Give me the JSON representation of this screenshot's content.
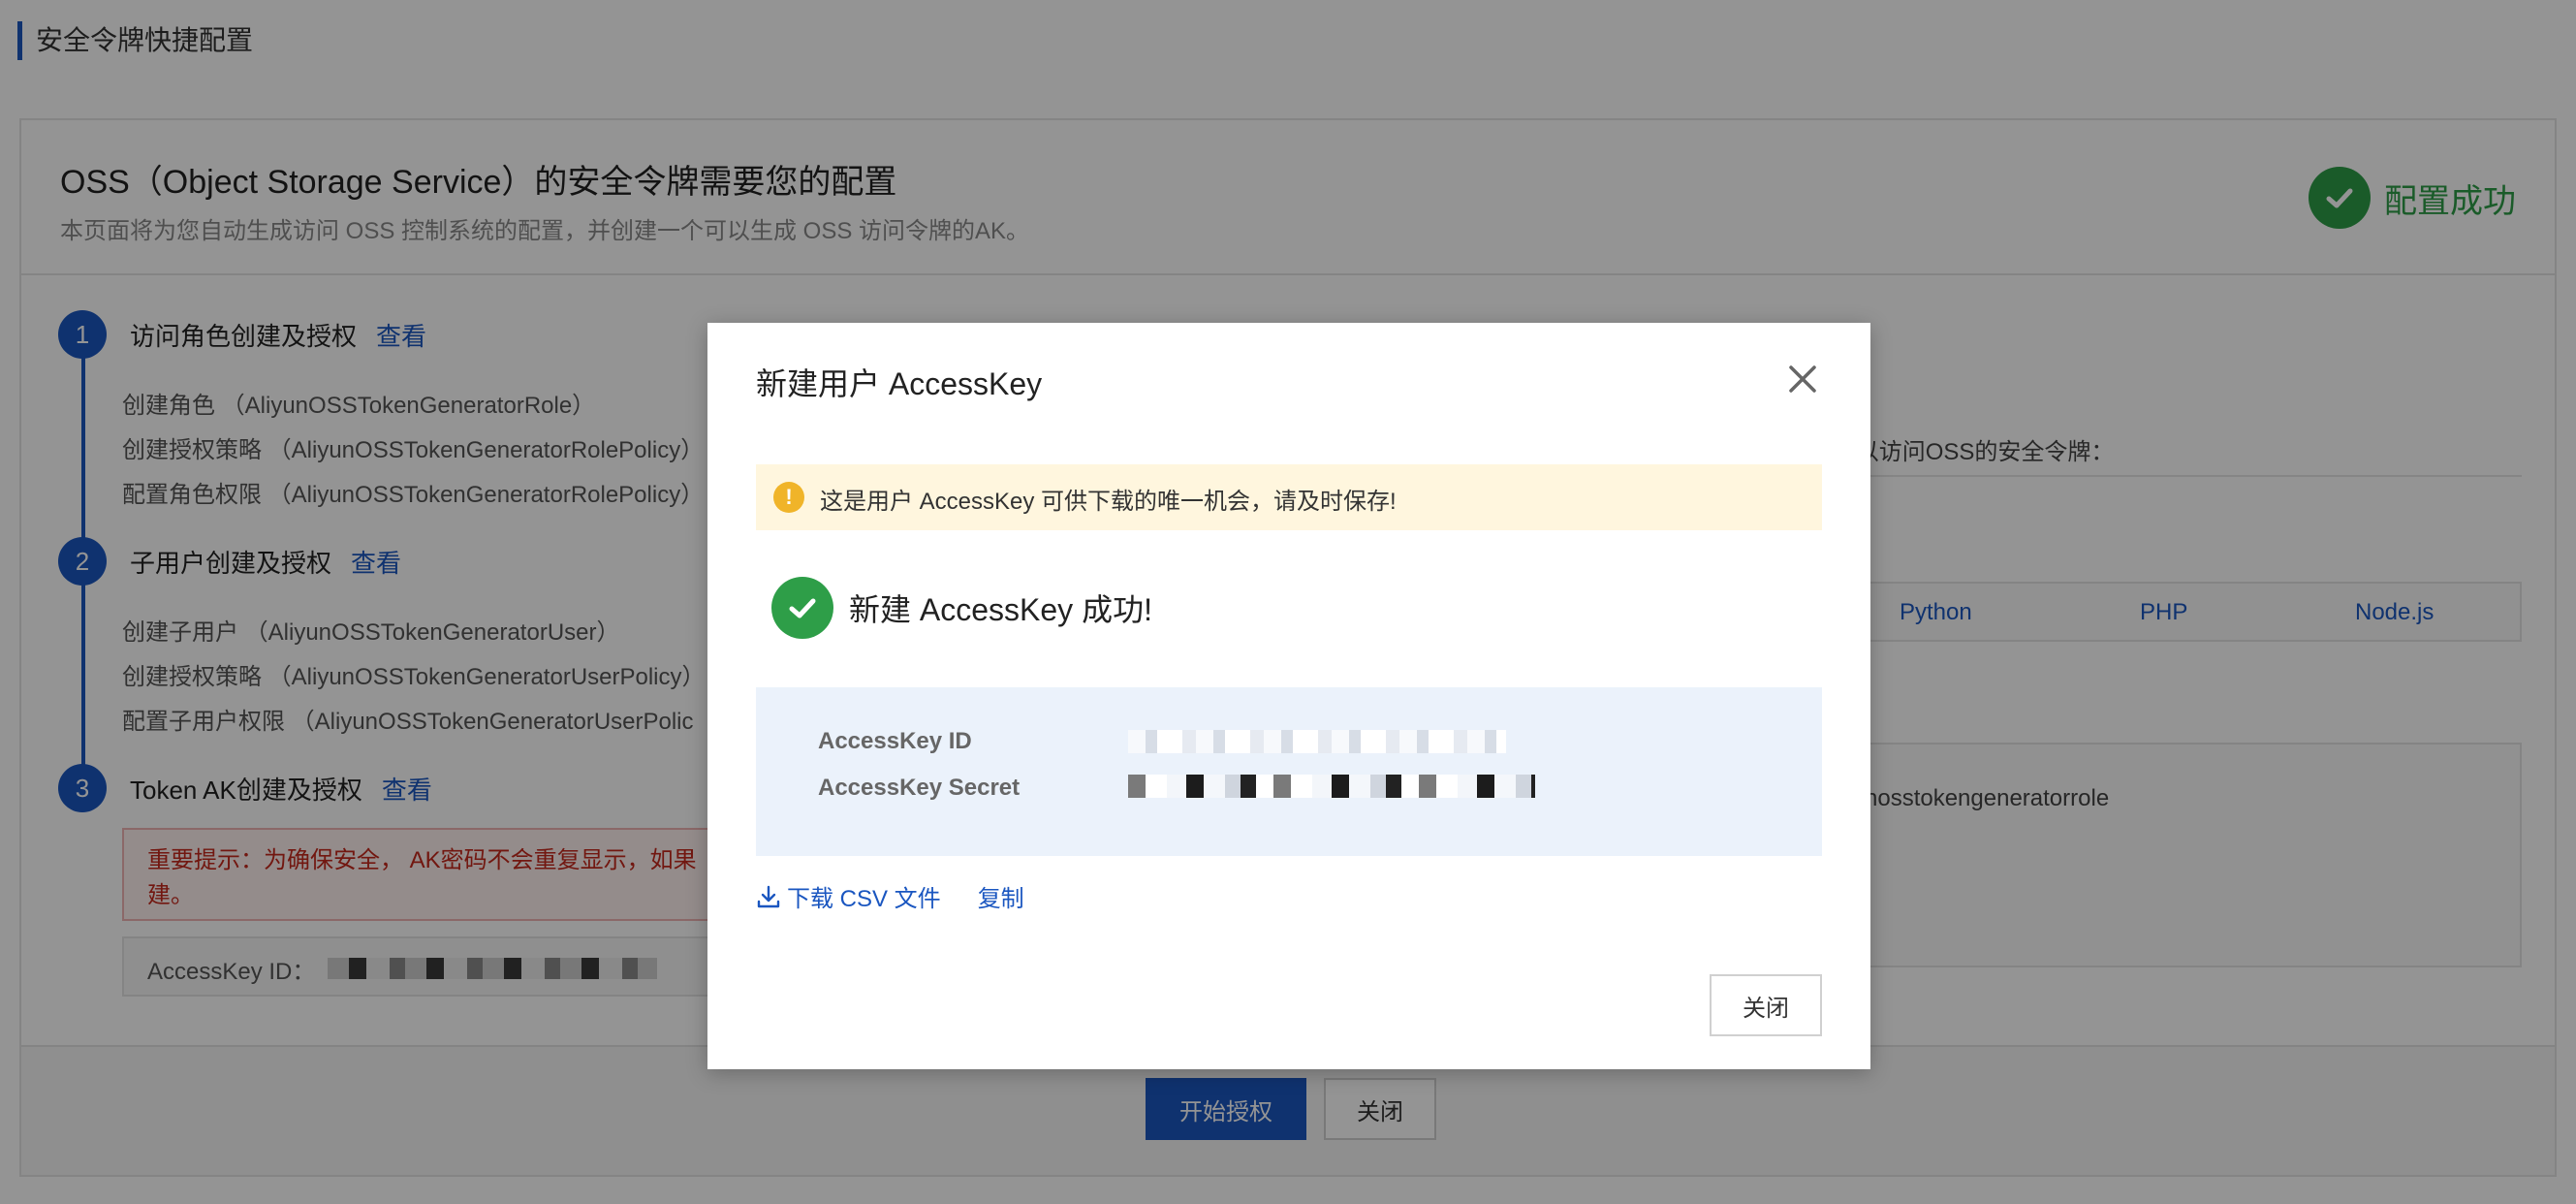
{
  "page": {
    "title": "安全令牌快捷配置"
  },
  "panel": {
    "title": "OSS（Object Storage Service）的安全令牌需要您的配置",
    "subtitle": "本页面将为您自动生成访问 OSS 控制系统的配置，并创建一个可以生成 OSS 访问令牌的AK。",
    "success_text": "配置成功"
  },
  "steps": [
    {
      "num": "1",
      "title": "访问角色创建及授权",
      "link": "查看",
      "items": [
        "创建角色 （AliyunOSSTokenGeneratorRole）",
        "创建授权策略 （AliyunOSSTokenGeneratorRolePolicy）",
        "配置角色权限 （AliyunOSSTokenGeneratorRolePolicy）"
      ]
    },
    {
      "num": "2",
      "title": "子用户创建及授权",
      "link": "查看",
      "items": [
        "创建子用户 （AliyunOSSTokenGeneratorUser）",
        "创建授权策略 （AliyunOSSTokenGeneratorUserPolicy）",
        "配置子用户权限 （AliyunOSSTokenGeneratorUserPolic"
      ]
    },
    {
      "num": "3",
      "title": "Token AK创建及授权",
      "link": "查看",
      "warning": "重要提示：为确保安全， AK密码不会重复显示，如果",
      "warning_line2": "建。",
      "ak_label": "AccessKey ID："
    }
  ],
  "right_pane": {
    "intro": "您可以使用STS SDK调用A       RoleArn接口来获取可以访问OSS的安全令牌：",
    "tabs": [
      "Python",
      "PHP",
      "Node.js"
    ],
    "code_text": "nosstokengeneratorrole"
  },
  "footer": {
    "primary": "开始授权",
    "secondary": "关闭"
  },
  "modal": {
    "title": "新建用户 AccessKey",
    "notice": "这是用户 AccessKey 可供下载的唯一机会，请及时保存!",
    "success": "新建 AccessKey 成功!",
    "id_label": "AccessKey ID",
    "secret_label": "AccessKey Secret",
    "download": "下载 CSV 文件",
    "copy": "复制",
    "close": "关闭"
  },
  "colors": {
    "primary": "#1a56c0",
    "success": "#2e9e48",
    "warning": "#f0b429",
    "danger": "#c4281c"
  }
}
